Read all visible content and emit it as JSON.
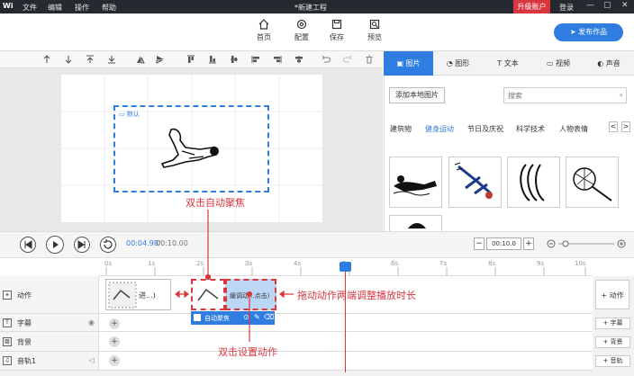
{
  "titlebar": {
    "logo": "Wi",
    "menu": [
      "文件",
      "编辑",
      "操作",
      "帮助"
    ],
    "title": "*新建工程",
    "upgrade": "升级账户",
    "login": "登录",
    "win_controls": [
      "—",
      "▢",
      "✕"
    ]
  },
  "toolbar": {
    "buttons": [
      {
        "label": "首页",
        "icon": "home-icon"
      },
      {
        "label": "配置",
        "icon": "gear-icon"
      },
      {
        "label": "保存",
        "icon": "save-icon"
      },
      {
        "label": "预览",
        "icon": "preview-icon"
      }
    ],
    "publish": "发布作品"
  },
  "canvas": {
    "selection_label": "默认"
  },
  "right_panel": {
    "tabs": [
      "图片",
      "图形",
      "文本",
      "视频",
      "声音"
    ],
    "active_tab": 0,
    "add_local": "添加本地图片",
    "search_placeholder": "搜索",
    "categories": [
      "建筑物",
      "健身运动",
      "节日及庆祝",
      "科学技术",
      "人物表情"
    ],
    "active_category": 1,
    "nav": [
      "<",
      ">"
    ]
  },
  "playbar": {
    "current_time": "00:04.98/",
    "total_time": "00:10.00",
    "zoom_minus": "−",
    "zoom_value": "00:10.0",
    "zoom_plus": "+"
  },
  "ruler": {
    "ticks": [
      "0s",
      "1s",
      "2s",
      "3s",
      "4s",
      "5s",
      "6s",
      "7s",
      "8s",
      "9s",
      "10s"
    ],
    "playhead_time": "4.98s"
  },
  "tracks": [
    {
      "name": "动作",
      "add": "+ 动作"
    },
    {
      "name": "字幕",
      "add": "+ 字幕"
    },
    {
      "name": "背景",
      "add": "+ 背景"
    },
    {
      "name": "音轨1",
      "add": "+ 音轨"
    }
  ],
  "clips": {
    "clip1": "进...)",
    "clip3": "缓调动...点击)",
    "popup_label": "自动聚焦"
  },
  "annotations": {
    "a1": "双击自动聚焦",
    "a2": "拖动动作两端调整播放时长",
    "a3": "双击设置动作"
  },
  "colors": {
    "accent": "#2f7de1",
    "annotation": "#d9363e",
    "titlebar": "#262a30"
  }
}
